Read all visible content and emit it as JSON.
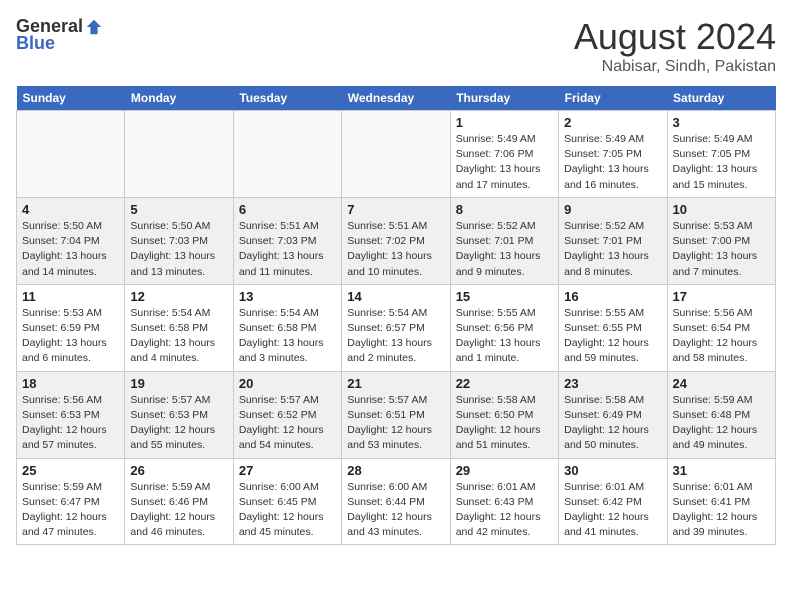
{
  "header": {
    "logo_general": "General",
    "logo_blue": "Blue",
    "month_year": "August 2024",
    "location": "Nabisar, Sindh, Pakistan"
  },
  "days_of_week": [
    "Sunday",
    "Monday",
    "Tuesday",
    "Wednesday",
    "Thursday",
    "Friday",
    "Saturday"
  ],
  "weeks": [
    [
      {
        "day": "",
        "info": ""
      },
      {
        "day": "",
        "info": ""
      },
      {
        "day": "",
        "info": ""
      },
      {
        "day": "",
        "info": ""
      },
      {
        "day": "1",
        "info": "Sunrise: 5:49 AM\nSunset: 7:06 PM\nDaylight: 13 hours\nand 17 minutes."
      },
      {
        "day": "2",
        "info": "Sunrise: 5:49 AM\nSunset: 7:05 PM\nDaylight: 13 hours\nand 16 minutes."
      },
      {
        "day": "3",
        "info": "Sunrise: 5:49 AM\nSunset: 7:05 PM\nDaylight: 13 hours\nand 15 minutes."
      }
    ],
    [
      {
        "day": "4",
        "info": "Sunrise: 5:50 AM\nSunset: 7:04 PM\nDaylight: 13 hours\nand 14 minutes."
      },
      {
        "day": "5",
        "info": "Sunrise: 5:50 AM\nSunset: 7:03 PM\nDaylight: 13 hours\nand 13 minutes."
      },
      {
        "day": "6",
        "info": "Sunrise: 5:51 AM\nSunset: 7:03 PM\nDaylight: 13 hours\nand 11 minutes."
      },
      {
        "day": "7",
        "info": "Sunrise: 5:51 AM\nSunset: 7:02 PM\nDaylight: 13 hours\nand 10 minutes."
      },
      {
        "day": "8",
        "info": "Sunrise: 5:52 AM\nSunset: 7:01 PM\nDaylight: 13 hours\nand 9 minutes."
      },
      {
        "day": "9",
        "info": "Sunrise: 5:52 AM\nSunset: 7:01 PM\nDaylight: 13 hours\nand 8 minutes."
      },
      {
        "day": "10",
        "info": "Sunrise: 5:53 AM\nSunset: 7:00 PM\nDaylight: 13 hours\nand 7 minutes."
      }
    ],
    [
      {
        "day": "11",
        "info": "Sunrise: 5:53 AM\nSunset: 6:59 PM\nDaylight: 13 hours\nand 6 minutes."
      },
      {
        "day": "12",
        "info": "Sunrise: 5:54 AM\nSunset: 6:58 PM\nDaylight: 13 hours\nand 4 minutes."
      },
      {
        "day": "13",
        "info": "Sunrise: 5:54 AM\nSunset: 6:58 PM\nDaylight: 13 hours\nand 3 minutes."
      },
      {
        "day": "14",
        "info": "Sunrise: 5:54 AM\nSunset: 6:57 PM\nDaylight: 13 hours\nand 2 minutes."
      },
      {
        "day": "15",
        "info": "Sunrise: 5:55 AM\nSunset: 6:56 PM\nDaylight: 13 hours\nand 1 minute."
      },
      {
        "day": "16",
        "info": "Sunrise: 5:55 AM\nSunset: 6:55 PM\nDaylight: 12 hours\nand 59 minutes."
      },
      {
        "day": "17",
        "info": "Sunrise: 5:56 AM\nSunset: 6:54 PM\nDaylight: 12 hours\nand 58 minutes."
      }
    ],
    [
      {
        "day": "18",
        "info": "Sunrise: 5:56 AM\nSunset: 6:53 PM\nDaylight: 12 hours\nand 57 minutes."
      },
      {
        "day": "19",
        "info": "Sunrise: 5:57 AM\nSunset: 6:53 PM\nDaylight: 12 hours\nand 55 minutes."
      },
      {
        "day": "20",
        "info": "Sunrise: 5:57 AM\nSunset: 6:52 PM\nDaylight: 12 hours\nand 54 minutes."
      },
      {
        "day": "21",
        "info": "Sunrise: 5:57 AM\nSunset: 6:51 PM\nDaylight: 12 hours\nand 53 minutes."
      },
      {
        "day": "22",
        "info": "Sunrise: 5:58 AM\nSunset: 6:50 PM\nDaylight: 12 hours\nand 51 minutes."
      },
      {
        "day": "23",
        "info": "Sunrise: 5:58 AM\nSunset: 6:49 PM\nDaylight: 12 hours\nand 50 minutes."
      },
      {
        "day": "24",
        "info": "Sunrise: 5:59 AM\nSunset: 6:48 PM\nDaylight: 12 hours\nand 49 minutes."
      }
    ],
    [
      {
        "day": "25",
        "info": "Sunrise: 5:59 AM\nSunset: 6:47 PM\nDaylight: 12 hours\nand 47 minutes."
      },
      {
        "day": "26",
        "info": "Sunrise: 5:59 AM\nSunset: 6:46 PM\nDaylight: 12 hours\nand 46 minutes."
      },
      {
        "day": "27",
        "info": "Sunrise: 6:00 AM\nSunset: 6:45 PM\nDaylight: 12 hours\nand 45 minutes."
      },
      {
        "day": "28",
        "info": "Sunrise: 6:00 AM\nSunset: 6:44 PM\nDaylight: 12 hours\nand 43 minutes."
      },
      {
        "day": "29",
        "info": "Sunrise: 6:01 AM\nSunset: 6:43 PM\nDaylight: 12 hours\nand 42 minutes."
      },
      {
        "day": "30",
        "info": "Sunrise: 6:01 AM\nSunset: 6:42 PM\nDaylight: 12 hours\nand 41 minutes."
      },
      {
        "day": "31",
        "info": "Sunrise: 6:01 AM\nSunset: 6:41 PM\nDaylight: 12 hours\nand 39 minutes."
      }
    ]
  ]
}
